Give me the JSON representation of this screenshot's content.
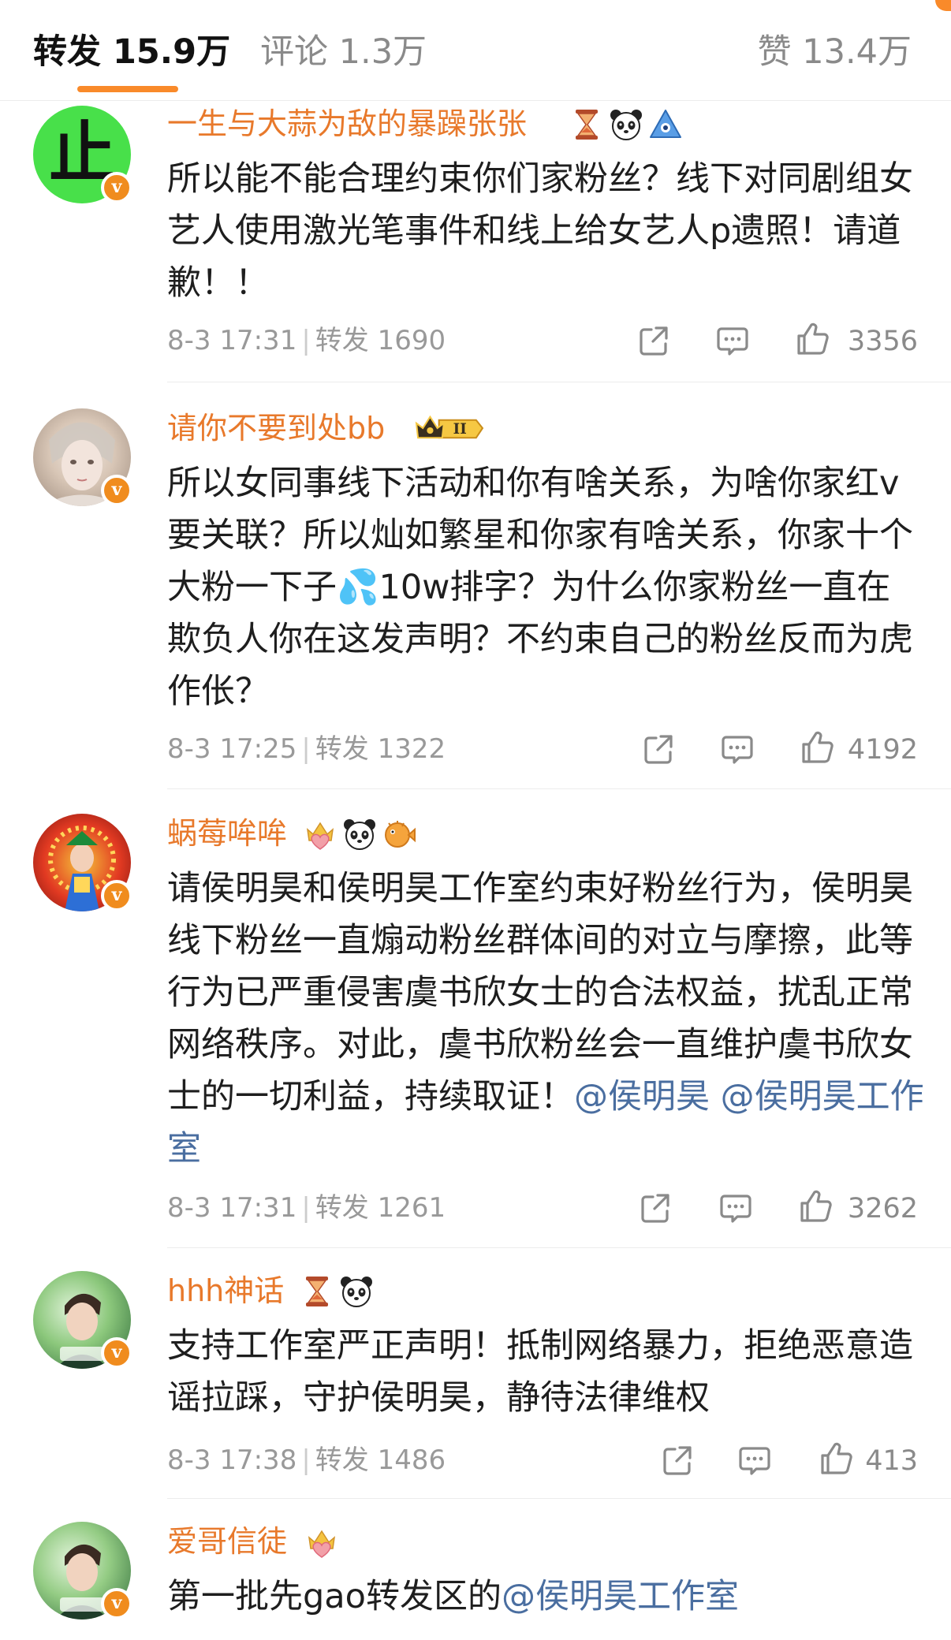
{
  "tabs": {
    "repost": "转发 15.9万",
    "comment": "评论 1.3万",
    "like": "赞 13.4万"
  },
  "colors": {
    "accent": "#f98a2a",
    "username": "#e8792b",
    "mention": "#4a6ea0",
    "meta": "#999999"
  },
  "comments": [
    {
      "username": "一生与大蒜为敌的暴躁张张",
      "badges": [
        "hourglass-icon",
        "panda-icon",
        "blue-triangle-icon"
      ],
      "text": "所以能不能合理约束你们家粉丝？线下对同剧组女艺人使用激光笔事件和线上给女艺人p遗照！请道歉！！",
      "time": "8-3 17:31",
      "repost_label": "转发 1690",
      "likes": "3356",
      "avatar_text": "止"
    },
    {
      "username": "请你不要到处bb",
      "badges": [
        "crown-level-badge"
      ],
      "level": "II",
      "text": "所以女同事线下活动和你有啥关系，为啥你家红v要关联？所以灿如繁星和你家有啥关系，你家十个大粉一下子💦10w排字？为什么你家粉丝一直在欺负人你在这发声明？不约束自己的粉丝反而为虎作伥？",
      "time": "8-3 17:25",
      "repost_label": "转发 1322",
      "likes": "4192"
    },
    {
      "username": "蜗莓哞哞",
      "badges": [
        "crown-heart-icon",
        "panda-icon",
        "pufferfish-icon"
      ],
      "text": "请侯明昊和侯明昊工作室约束好粉丝行为，侯明昊线下粉丝一直煽动粉丝群体间的对立与摩擦，此等行为已严重侵害虞书欣女士的合法权益，扰乱正常网络秩序。对此，虞书欣粉丝会一直维护虞书欣女士的一切利益，持续取证！",
      "mention1": "@侯明昊",
      "mention2": "@侯明昊工作室",
      "time": "8-3 17:31",
      "repost_label": "转发 1261",
      "likes": "3262"
    },
    {
      "username": "hhh神话",
      "badges": [
        "hourglass-icon",
        "panda-icon"
      ],
      "text": "支持工作室严正声明！抵制网络暴力，拒绝恶意造谣拉踩，守护侯明昊，静待法律维权",
      "time": "8-3 17:38",
      "repost_label": "转发 1486",
      "likes": "413"
    },
    {
      "username": "爱哥信徒",
      "badges": [
        "crown-heart-icon"
      ],
      "text": "第一批先gao转发区的",
      "mention1": "@侯明昊工作室"
    }
  ]
}
